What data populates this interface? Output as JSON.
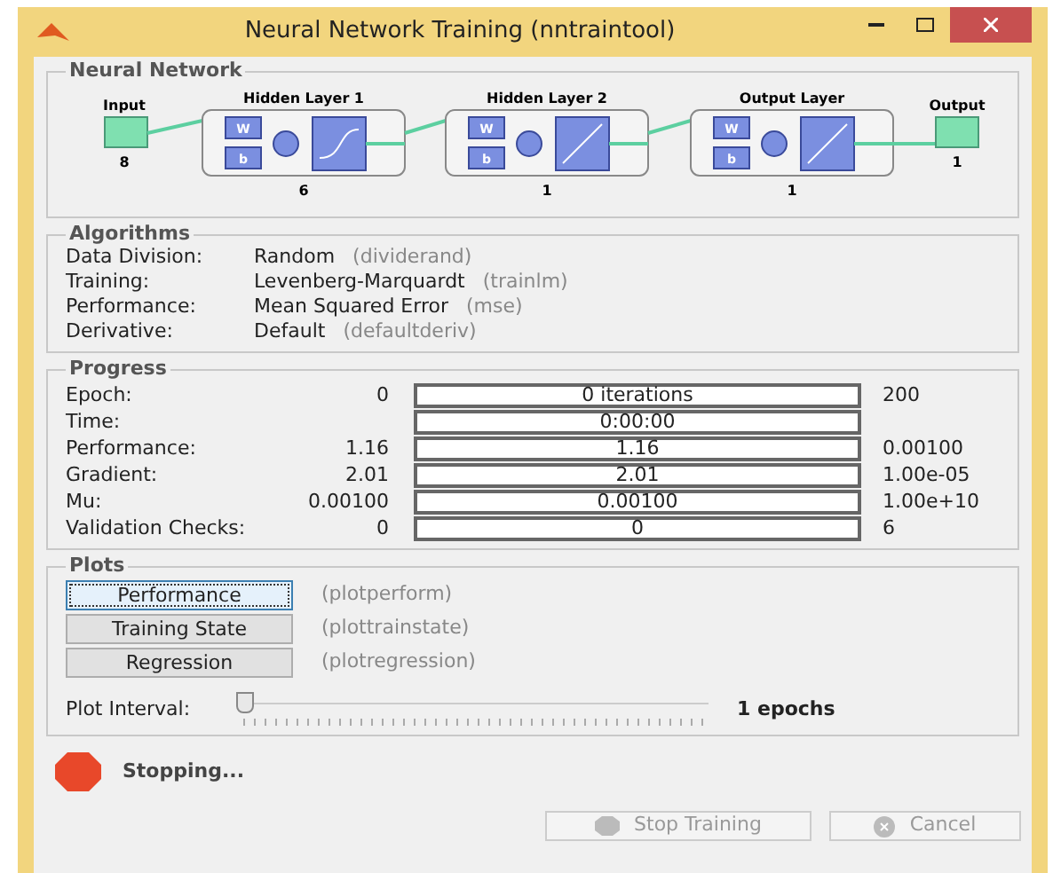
{
  "window": {
    "title": "Neural Network Training (nntraintool)"
  },
  "network": {
    "title": "Neural Network",
    "input": {
      "label": "Input",
      "size": "8"
    },
    "layers": [
      {
        "title": "Hidden Layer 1",
        "size": "6",
        "kind": "sigmoid",
        "weight": "W",
        "bias": "b"
      },
      {
        "title": "Hidden Layer 2",
        "size": "1",
        "kind": "linear",
        "weight": "W",
        "bias": "b"
      },
      {
        "title": "Output Layer",
        "size": "1",
        "kind": "linear",
        "weight": "W",
        "bias": "b"
      }
    ],
    "output": {
      "label": "Output",
      "size": "1"
    }
  },
  "algorithms": {
    "title": "Algorithms",
    "rows": [
      {
        "label": "Data Division:",
        "value": "Random",
        "function": "(dividerand)"
      },
      {
        "label": "Training:",
        "value": "Levenberg-Marquardt",
        "function": "(trainlm)"
      },
      {
        "label": "Performance:",
        "value": "Mean Squared Error",
        "function": "(mse)"
      },
      {
        "label": "Derivative:",
        "value": "Default",
        "function": "(defaultderiv)"
      }
    ]
  },
  "progress": {
    "title": "Progress",
    "rows": [
      {
        "label": "Epoch:",
        "start": "0",
        "value": "0 iterations",
        "end": "200"
      },
      {
        "label": "Time:",
        "value": "0:00:00"
      },
      {
        "label": "Performance:",
        "start": "1.16",
        "value": "1.16",
        "end": "0.00100"
      },
      {
        "label": "Gradient:",
        "start": "2.01",
        "value": "2.01",
        "end": "1.00e-05"
      },
      {
        "label": "Mu:",
        "start": "0.00100",
        "value": "0.00100",
        "end": "1.00e+10"
      },
      {
        "label": "Validation Checks:",
        "start": "0",
        "value": "0",
        "end": "6"
      }
    ]
  },
  "plots": {
    "title": "Plots",
    "buttons": [
      {
        "label": "Performance",
        "function": "(plotperform)",
        "focused": true
      },
      {
        "label": "Training State",
        "function": "(plottrainstate)",
        "focused": false
      },
      {
        "label": "Regression",
        "function": "(plotregression)",
        "focused": false
      }
    ],
    "interval": {
      "label": "Plot Interval:",
      "level": 0,
      "reading": "1 epochs"
    }
  },
  "status": {
    "text": "Stopping..."
  },
  "buttons": [
    {
      "label": "Stop Training",
      "kind": "stop",
      "disabled": true
    },
    {
      "label": "Cancel",
      "kind": "cancel",
      "disabled": true
    }
  ]
}
